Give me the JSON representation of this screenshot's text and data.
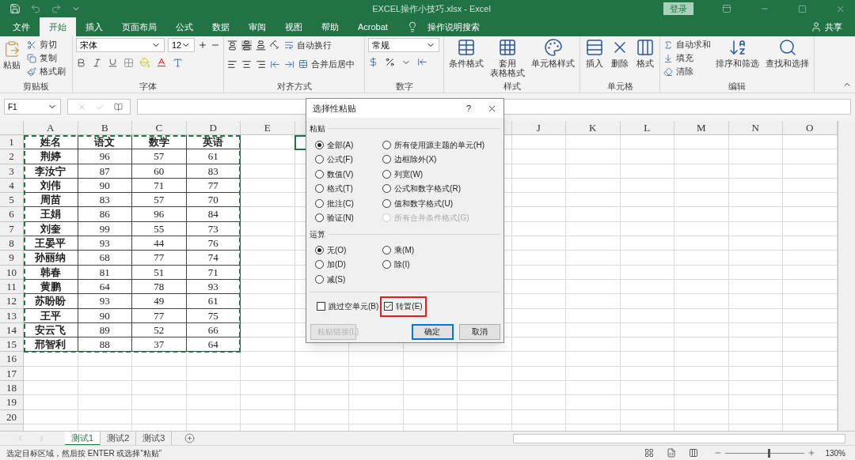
{
  "title_bar": {
    "title": "EXCEL操作小技巧.xlsx  -  Excel",
    "sign_in": "登录"
  },
  "ribbon_tabs": [
    {
      "label": "文件",
      "selected": false
    },
    {
      "label": "开始",
      "selected": true
    },
    {
      "label": "插入",
      "selected": false
    },
    {
      "label": "页面布局",
      "selected": false
    },
    {
      "label": "公式",
      "selected": false
    },
    {
      "label": "数据",
      "selected": false
    },
    {
      "label": "审阅",
      "selected": false
    },
    {
      "label": "视图",
      "selected": false
    },
    {
      "label": "帮助",
      "selected": false
    },
    {
      "label": "Acrobat",
      "selected": false
    }
  ],
  "tell_me": "操作说明搜索",
  "share": "共享",
  "clipboard": {
    "label": "剪贴板",
    "paste": "粘贴",
    "cut": "剪切",
    "copy": "复制",
    "format_painter": "格式刷"
  },
  "font": {
    "label": "字体",
    "name": "宋体",
    "size": "12"
  },
  "alignment": {
    "label": "对齐方式",
    "wrap_text": "自动换行",
    "merge_center": "合并后居中"
  },
  "number": {
    "label": "数字",
    "format": "常规"
  },
  "styles": {
    "label": "样式",
    "buttons": [
      {
        "lines": [
          "条件格式"
        ]
      },
      {
        "lines": [
          "套用",
          "表格格式"
        ]
      },
      {
        "lines": [
          "单元格样式"
        ]
      }
    ]
  },
  "cells": {
    "label": "单元格",
    "buttons": [
      {
        "lines": [
          "插入"
        ]
      },
      {
        "lines": [
          "删除"
        ]
      },
      {
        "lines": [
          "格式"
        ]
      }
    ]
  },
  "editing": {
    "label": "编辑",
    "autosum": "自动求和",
    "fill": "填充",
    "clear": "清除",
    "sort_filter": "排序和筛选",
    "find_select": "查找和选择"
  },
  "name_box": "F1",
  "columns": [
    "A",
    "B",
    "C",
    "D",
    "E",
    "J",
    "K",
    "L",
    "M",
    "N",
    "O"
  ],
  "row_numbers": [
    "1",
    "2",
    "3",
    "4",
    "5",
    "6",
    "7",
    "8",
    "9",
    "10",
    "11",
    "12",
    "13",
    "14",
    "15",
    "16",
    "17",
    "18",
    "19",
    "20"
  ],
  "rows": [
    [
      "姓名",
      "语文",
      "数学",
      "英语"
    ],
    [
      "荆婷",
      "96",
      "57",
      "61"
    ],
    [
      "李汝宁",
      "87",
      "60",
      "83"
    ],
    [
      "刘伟",
      "90",
      "71",
      "77"
    ],
    [
      "周苗",
      "83",
      "57",
      "70"
    ],
    [
      "王娟",
      "86",
      "96",
      "84"
    ],
    [
      "刘奎",
      "99",
      "55",
      "73"
    ],
    [
      "王晏平",
      "93",
      "44",
      "76"
    ],
    [
      "孙丽纳",
      "68",
      "77",
      "74"
    ],
    [
      "韩春",
      "81",
      "51",
      "71"
    ],
    [
      "黄鹏",
      "64",
      "78",
      "93"
    ],
    [
      "苏盼盼",
      "93",
      "49",
      "61"
    ],
    [
      "王平",
      "90",
      "77",
      "75"
    ],
    [
      "安云飞",
      "89",
      "52",
      "66"
    ],
    [
      "邢智利",
      "88",
      "37",
      "64"
    ]
  ],
  "dialog": {
    "title": "选择性粘贴",
    "help": "?",
    "paste_label": "粘贴",
    "paste_options": [
      {
        "label": "全部(A)",
        "selected": true,
        "disabled": false
      },
      {
        "label": "所有使用源主题的单元(H)",
        "selected": false,
        "disabled": false
      },
      {
        "label": "公式(F)",
        "selected": false,
        "disabled": false
      },
      {
        "label": "边框除外(X)",
        "selected": false,
        "disabled": false
      },
      {
        "label": "数值(V)",
        "selected": false,
        "disabled": false
      },
      {
        "label": "列宽(W)",
        "selected": false,
        "disabled": false
      },
      {
        "label": "格式(T)",
        "selected": false,
        "disabled": false
      },
      {
        "label": "公式和数字格式(R)",
        "selected": false,
        "disabled": false
      },
      {
        "label": "批注(C)",
        "selected": false,
        "disabled": false
      },
      {
        "label": "值和数字格式(U)",
        "selected": false,
        "disabled": false
      },
      {
        "label": "验证(N)",
        "selected": false,
        "disabled": false
      },
      {
        "label": "所有合并条件格式(G)",
        "selected": false,
        "disabled": true
      }
    ],
    "operation_label": "运算",
    "operations": [
      {
        "label": "无(O)",
        "selected": true
      },
      {
        "label": "乘(M)",
        "selected": false
      },
      {
        "label": "加(D)",
        "selected": false
      },
      {
        "label": "除(I)",
        "selected": false
      },
      {
        "label": "减(S)",
        "selected": false
      }
    ],
    "checkboxes": [
      {
        "label": "跳过空单元(B)",
        "checked": false,
        "highlighted": false
      },
      {
        "label": "转置(E)",
        "checked": true,
        "highlighted": true
      }
    ],
    "buttons": [
      {
        "label": "粘贴链接(L)",
        "disabled": true,
        "default": false
      },
      {
        "label": "确定",
        "disabled": false,
        "default": true
      },
      {
        "label": "取消",
        "disabled": false,
        "default": false
      }
    ]
  },
  "sheet_tabs": [
    {
      "label": "测试1",
      "selected": true
    },
    {
      "label": "测试2",
      "selected": false
    },
    {
      "label": "测试3",
      "selected": false
    }
  ],
  "status_bar": {
    "message": "选定目标区域，然后按 ENTER 或选择“粘贴”",
    "zoom": "130%",
    "zoom_slider": {
      "level": 0.55
    }
  }
}
